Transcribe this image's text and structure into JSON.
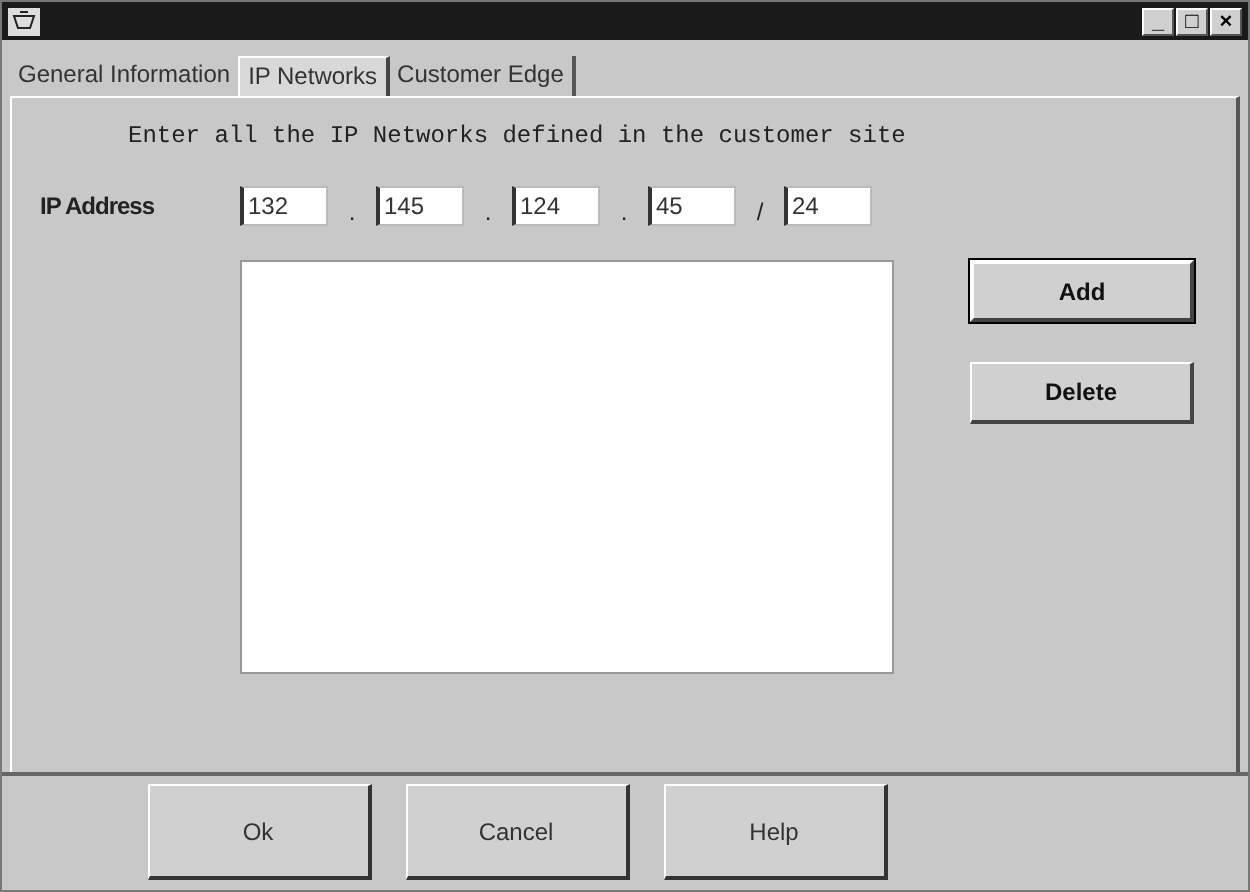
{
  "window": {
    "controls": [
      "_",
      "□",
      "×"
    ]
  },
  "tabs": [
    {
      "label": "General Information",
      "selected": false
    },
    {
      "label": "IP Networks",
      "selected": true
    },
    {
      "label": "Customer Edge",
      "selected": false
    }
  ],
  "instruction": "Enter all the IP Networks defined in the customer site",
  "ip_address": {
    "label": "IP Address",
    "parts": [
      {
        "value": "132"
      },
      {
        "separator": ".",
        "value": "145"
      },
      {
        "separator": ".",
        "value": "124"
      },
      {
        "separator": ".",
        "value": "45"
      },
      {
        "separator": "/",
        "value": "24"
      }
    ]
  },
  "side_buttons": [
    {
      "label": "Add",
      "default": true
    },
    {
      "label": "Delete",
      "default": false
    }
  ],
  "buttons": [
    "Ok",
    "Cancel",
    "Help"
  ]
}
